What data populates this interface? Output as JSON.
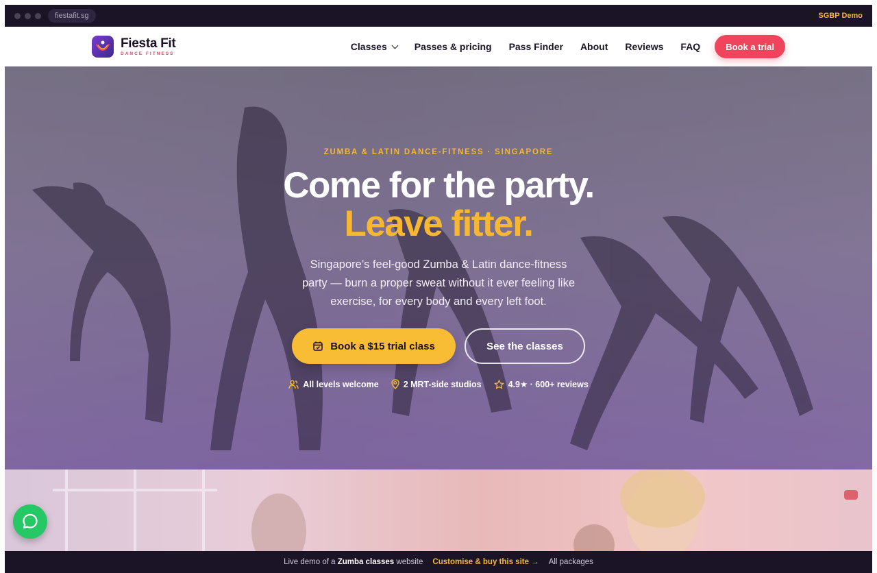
{
  "browser": {
    "url": "fiestafit.sg",
    "demo_tag": "SGBP Demo"
  },
  "brand": {
    "name": "Fiesta Fit",
    "tagline": "DANCE FITNESS"
  },
  "nav": {
    "items": [
      "Classes",
      "Passes & pricing",
      "Pass Finder",
      "About",
      "Reviews",
      "FAQ"
    ],
    "cta": "Book a trial"
  },
  "hero": {
    "eyebrow": "ZUMBA & LATIN DANCE-FITNESS · SINGAPORE",
    "headline_1": "Come for the party.",
    "headline_2": "Leave fitter.",
    "lede": "Singapore’s feel-good Zumba & Latin dance-fitness party — burn a proper sweat without it ever feeling like exercise, for every body and every left foot.",
    "primary_cta": "Book a $15 trial class",
    "secondary_cta": "See the classes",
    "trust": [
      "All levels welcome",
      "2 MRT-side studios",
      "4.9★ · 600+ reviews"
    ]
  },
  "bottom_bar": {
    "prefix": "Live demo of a",
    "highlight": "Zumba classes",
    "suffix": "website",
    "customise": "Customise & buy this site →",
    "packages": "All packages"
  },
  "colors": {
    "accent": "#f7b733",
    "brand_red": "#f0445c",
    "dark": "#1b1426",
    "whatsapp": "#25c865"
  }
}
